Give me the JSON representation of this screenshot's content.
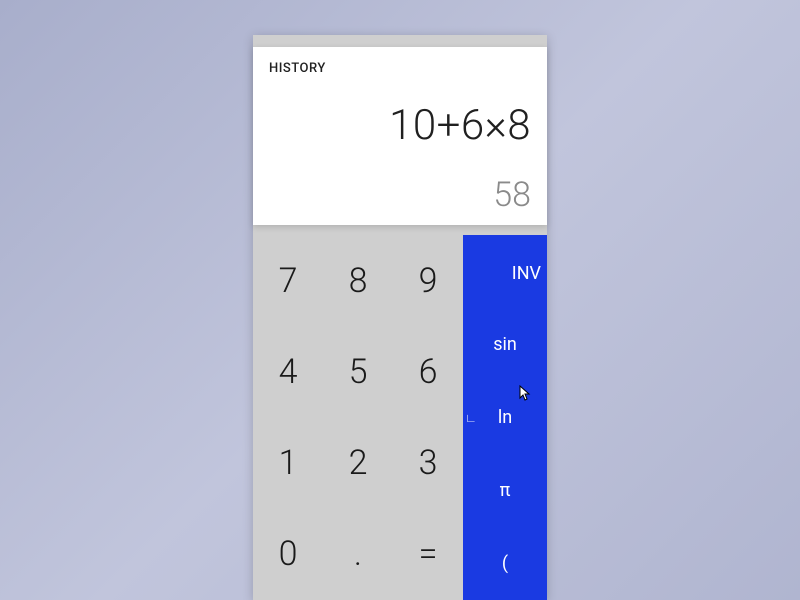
{
  "display": {
    "history_label": "HISTORY",
    "expression": "10+6×8",
    "result": "58"
  },
  "numpad": {
    "r0": [
      "7",
      "8",
      "9"
    ],
    "r1": [
      "4",
      "5",
      "6"
    ],
    "r2": [
      "1",
      "2",
      "3"
    ],
    "r3": [
      "0",
      ".",
      "="
    ]
  },
  "sci": {
    "inv": "INV",
    "sin": "sin",
    "ln": "ln",
    "pi": "π",
    "paren": "("
  }
}
